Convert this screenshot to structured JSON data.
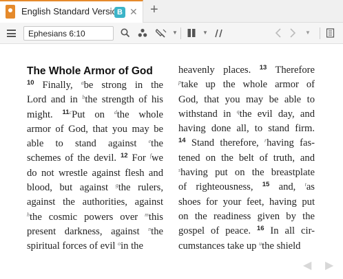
{
  "tab": {
    "title": "English Standard Version",
    "badge": "B",
    "close": "✕",
    "add": "+"
  },
  "toolbar": {
    "reference": "Ephesians 6:10",
    "search_icon": "search-icon",
    "visual_filters_icon": "visual-filters-icon",
    "highlight_icon": "highlight-icon",
    "layout_icon": "columns-icon",
    "parallel_icon": "parallel-icon",
    "back": "‹",
    "forward": "›"
  },
  "passage": {
    "heading": "The Whole Armor of God",
    "col1_lines": [
      [
        {
          "v": "10"
        },
        {
          "t": " Finally, "
        },
        {
          "c": "a"
        },
        {
          "t": "be strong in the"
        }
      ],
      [
        {
          "t": "Lord and in "
        },
        {
          "c": "b"
        },
        {
          "t": "the strength of his"
        }
      ],
      [
        {
          "t": "might. "
        },
        {
          "v": "11"
        },
        {
          "c": "c"
        },
        {
          "t": "Put on "
        },
        {
          "c": "d"
        },
        {
          "t": "the whole"
        }
      ],
      [
        {
          "t": "armor of God, that you may be"
        }
      ],
      [
        {
          "t": "able to stand against "
        },
        {
          "c": "e"
        },
        {
          "t": "the"
        }
      ],
      [
        {
          "t": "schemes of the devil. "
        },
        {
          "v": "12"
        },
        {
          "t": " For "
        },
        {
          "c": "f"
        },
        {
          "t": "we"
        }
      ],
      [
        {
          "t": "do not wrestle against flesh and"
        }
      ],
      [
        {
          "t": "blood, but against "
        },
        {
          "c": "g"
        },
        {
          "t": "the rulers,"
        }
      ],
      [
        {
          "t": "against the authorities, against"
        }
      ],
      [
        {
          "c": "h"
        },
        {
          "t": "the cosmic powers over "
        },
        {
          "c": "m"
        },
        {
          "t": "this"
        }
      ],
      [
        {
          "t": "present darkness, against "
        },
        {
          "c": "n"
        },
        {
          "t": "the"
        }
      ],
      [
        {
          "t": "spiritual forces of evil "
        },
        {
          "c": "o"
        },
        {
          "t": "in the"
        }
      ]
    ],
    "col2_lines": [
      [
        {
          "t": "heavenly places. "
        },
        {
          "v": "13"
        },
        {
          "t": " Therefore"
        }
      ],
      [
        {
          "c": "p"
        },
        {
          "t": "take up the whole armor of"
        }
      ],
      [
        {
          "t": "God, that you may be able to"
        }
      ],
      [
        {
          "t": "withstand in "
        },
        {
          "c": "q"
        },
        {
          "t": "the evil day, and"
        }
      ],
      [
        {
          "t": "having done all, to stand firm."
        }
      ],
      [
        {
          "v": "14"
        },
        {
          "t": " Stand therefore, "
        },
        {
          "c": "r"
        },
        {
          "t": "having fas-"
        }
      ],
      [
        {
          "t": "tened on the belt of truth, and"
        }
      ],
      [
        {
          "c": "s"
        },
        {
          "t": "having put on the breastplate"
        }
      ],
      [
        {
          "t": "of righteousness, "
        },
        {
          "v": "15"
        },
        {
          "t": " and, "
        },
        {
          "c": "t"
        },
        {
          "t": "as"
        }
      ],
      [
        {
          "t": "shoes for your feet, having put"
        }
      ],
      [
        {
          "t": "on the readiness given by the"
        }
      ],
      [
        {
          "t": "gospel of peace. "
        },
        {
          "v": "16"
        },
        {
          "t": " In all cir-"
        }
      ],
      [
        {
          "t": "cumstances take up "
        },
        {
          "c": "u"
        },
        {
          "t": "the shield"
        }
      ]
    ]
  },
  "nav": {
    "prev": "◀",
    "next": "▶"
  }
}
